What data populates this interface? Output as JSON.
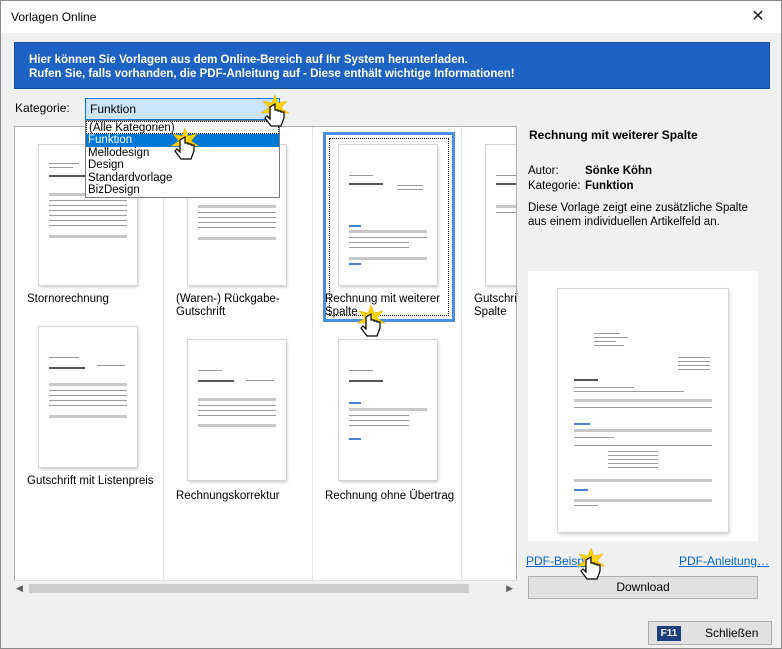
{
  "window": {
    "title": "Vorlagen Online",
    "close_glyph": "✕"
  },
  "banner": {
    "line1": "Hier können Sie Vorlagen aus dem Online-Bereich auf Ihr System herunterladen.",
    "line2": "Rufen Sie, falls vorhanden, die PDF-Anleitung auf - Diese enthält wichtige Informationen!"
  },
  "kategorie": {
    "label": "Kategorie:",
    "selected": "Funktion",
    "options": [
      "(Alle Kategorien)",
      "Funktion",
      "Mellodesign",
      "Design",
      "Standardvorlage",
      "BizDesign"
    ]
  },
  "templates": [
    {
      "label": "Stornorechnung"
    },
    {
      "label": "(Waren-) Rückgabe-Gutschrift"
    },
    {
      "label": "Rechnung mit weiterer Spalte"
    },
    {
      "label": "Gutschrift Spalte"
    },
    {
      "label": "Gutschrift mit Listenpreis"
    },
    {
      "label": "Rechnungskorrektur"
    },
    {
      "label": "Rechnung ohne Übertrag"
    }
  ],
  "detail": {
    "title": "Rechnung mit weiterer Spalte",
    "author_key": "Autor:",
    "author": "Sönke Köhn",
    "category_key": "Kategorie:",
    "category": "Funktion",
    "description": "Diese Vorlage zeigt eine zusätzliche Spalte aus einem individuellen Artikelfeld an."
  },
  "links": {
    "pdf_example": "PDF-Beispiel",
    "pdf_guide": "PDF-Anleitung…"
  },
  "buttons": {
    "download": "Download",
    "close_key": "F11",
    "close": "Schließen"
  }
}
